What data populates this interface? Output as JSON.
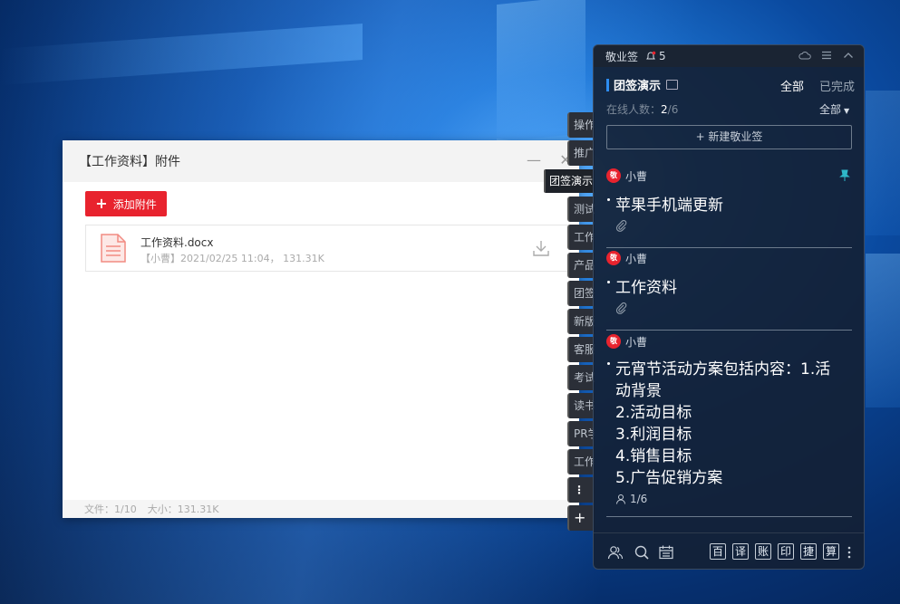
{
  "attachment_window": {
    "title": "【工作资料】附件",
    "minimize_glyph": "—",
    "close_glyph": "✕",
    "add_button_label": "添加附件",
    "file": {
      "name": "工作资料.docx",
      "meta": "【小曹】2021/02/25 11:04， 131.31K"
    },
    "footer": {
      "files": "文件：1/10",
      "size": "大小：131.31K"
    }
  },
  "side_tabs": [
    "操作",
    "推广",
    "测试",
    "工作",
    "产品",
    "团签",
    "新版",
    "客服",
    "考试",
    "读书",
    "PR学",
    "工作"
  ],
  "side_tab_popup": "团签演示",
  "side_more_glyph": "⋮",
  "side_add_glyph": "+",
  "panel": {
    "app_name": "敬业签",
    "bell_count": "5",
    "group_title": "团签演示",
    "filter_all": "全部",
    "filter_done": "已完成",
    "online_label": "在线人数：",
    "online_current": "2",
    "online_total": "/6",
    "all_dropdown": "全部",
    "new_note_label": "+ 新建敬业签",
    "notes": [
      {
        "user": "小曹",
        "text": "苹果手机端更新"
      },
      {
        "user": "小曹",
        "text": "工作资料"
      },
      {
        "user": "小曹",
        "text_lines": [
          "元宵节活动方案包括内容：1.活",
          "动背景",
          "2.活动目标",
          "3.利润目标",
          "4.销售目标",
          "5.广告促销方案"
        ],
        "subtask": "1/6"
      }
    ],
    "bottom_chars": [
      "百",
      "译",
      "账",
      "印",
      "捷",
      "算"
    ]
  },
  "colors": {
    "accent_red": "#e8232e",
    "accent_blue": "#2d8cf0",
    "panel_bg": "#132135"
  }
}
